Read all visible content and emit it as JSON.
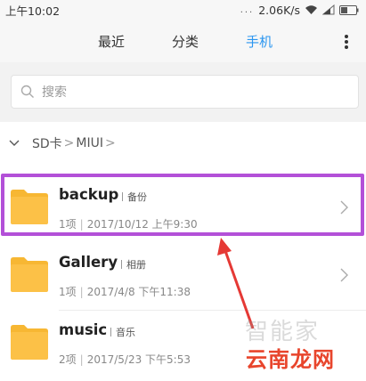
{
  "status_bar": {
    "time": "上午10:02",
    "dots": "...",
    "speed": "2.06K/s"
  },
  "tabs": [
    {
      "label": "最近",
      "active": false
    },
    {
      "label": "分类",
      "active": false
    },
    {
      "label": "手机",
      "active": true
    }
  ],
  "search": {
    "placeholder": "搜索"
  },
  "breadcrumb": {
    "items": [
      "SD卡",
      "MIUI"
    ],
    "separator": ">"
  },
  "files": [
    {
      "name": "backup",
      "tag": "备份",
      "count": "1项",
      "date": "2017/10/12 上午9:30"
    },
    {
      "name": "Gallery",
      "tag": "相册",
      "count": "1项",
      "date": "2017/4/8 下午11:38"
    },
    {
      "name": "music",
      "tag": "音乐",
      "count": "2项",
      "date": "2017/5/23 下午5:53"
    }
  ],
  "watermark": {
    "top": "智能家",
    "logo": "云南龙网"
  },
  "colors": {
    "accent": "#2b96f0",
    "folder": "#f7b733",
    "highlight": "#b350d8",
    "arrow": "#e53935"
  }
}
